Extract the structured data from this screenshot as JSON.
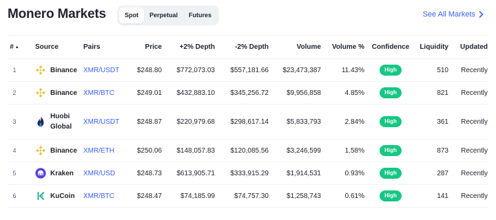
{
  "header": {
    "title": "Monero Markets",
    "tabs": [
      {
        "label": "Spot",
        "active": true
      },
      {
        "label": "Perpetual",
        "active": false
      },
      {
        "label": "Futures",
        "active": false
      }
    ],
    "see_all_label": "See All Markets"
  },
  "colors": {
    "accent": "#3861fb",
    "high_badge": "#16c784",
    "text": "#222531",
    "muted": "#58667e"
  },
  "table": {
    "columns": {
      "rank": "#",
      "source": "Source",
      "pairs": "Pairs",
      "price": "Price",
      "depth_plus": "+2% Depth",
      "depth_minus": "-2% Depth",
      "volume": "Volume",
      "volume_pct": "Volume %",
      "confidence": "Confidence",
      "liquidity": "Liquidity",
      "updated": "Updated"
    },
    "sort_indicator": "▲",
    "rows": [
      {
        "rank": "1",
        "source": "Binance",
        "logo": "binance-icon",
        "pair": "XMR/USDT",
        "price": "$248.80",
        "depth_plus": "$772,073.03",
        "depth_minus": "$557,181.66",
        "volume": "$23,473,387",
        "volume_pct": "11.43%",
        "confidence": "High",
        "liquidity": "510",
        "updated": "Recently"
      },
      {
        "rank": "2",
        "source": "Binance",
        "logo": "binance-icon",
        "pair": "XMR/BTC",
        "price": "$249.01",
        "depth_plus": "$432,883.10",
        "depth_minus": "$345,256.72",
        "volume": "$9,956,858",
        "volume_pct": "4.85%",
        "confidence": "High",
        "liquidity": "821",
        "updated": "Recently"
      },
      {
        "rank": "3",
        "source": "Huobi Global",
        "source_line1": "Huobi",
        "source_line2": "Global",
        "logo": "huobi-icon",
        "pair": "XMR/USDT",
        "price": "$248.87",
        "depth_plus": "$220,979.68",
        "depth_minus": "$298,617.14",
        "volume": "$5,833,793",
        "volume_pct": "2.84%",
        "confidence": "High",
        "liquidity": "361",
        "updated": "Recently"
      },
      {
        "rank": "4",
        "source": "Binance",
        "logo": "binance-icon",
        "pair": "XMR/ETH",
        "price": "$250.06",
        "depth_plus": "$148,057.83",
        "depth_minus": "$120,085.56",
        "volume": "$3,246,599",
        "volume_pct": "1.58%",
        "confidence": "High",
        "liquidity": "873",
        "updated": "Recently"
      },
      {
        "rank": "5",
        "source": "Kraken",
        "logo": "kraken-icon",
        "pair": "XMR/USD",
        "price": "$248.73",
        "depth_plus": "$613,905.71",
        "depth_minus": "$333,915.29",
        "volume": "$1,914,531",
        "volume_pct": "0.93%",
        "confidence": "High",
        "liquidity": "287",
        "updated": "Recently"
      },
      {
        "rank": "6",
        "source": "KuCoin",
        "logo": "kucoin-icon",
        "pair": "XMR/BTC",
        "price": "$248.47",
        "depth_plus": "$74,185.99",
        "depth_minus": "$74,757.30",
        "volume": "$1,258,743",
        "volume_pct": "0.61%",
        "confidence": "High",
        "liquidity": "141",
        "updated": "Recently"
      }
    ]
  }
}
